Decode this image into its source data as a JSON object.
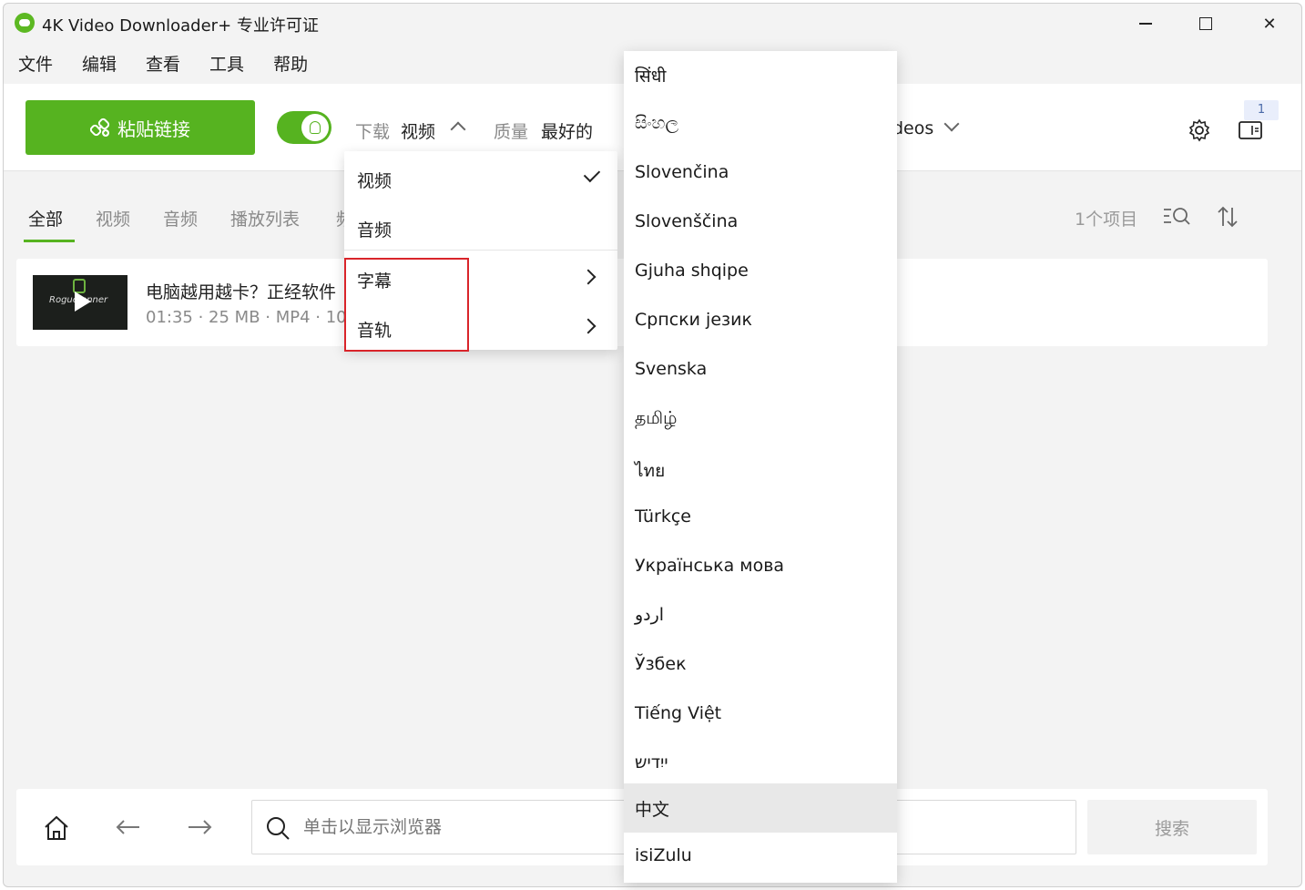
{
  "window": {
    "title": "4K Video Downloader+ 专业许可证",
    "min_label": "",
    "max_label": "",
    "close_label": "✕"
  },
  "menu": [
    "文件",
    "编辑",
    "查看",
    "工具",
    "帮助"
  ],
  "toolbar": {
    "paste_label": "粘贴链接",
    "download_label": "下载",
    "download_value": "视频",
    "quality_label": "质量",
    "quality_value": "最好的",
    "folder_partial": "deos",
    "badge_count": "1"
  },
  "tabs": [
    "全部",
    "视频",
    "音频",
    "播放列表",
    "频"
  ],
  "item_count": "1个项目",
  "item": {
    "title": "电脑越用越卡？正经软件",
    "meta": "01:35 · 25 MB · MP4 · 10",
    "thumb_text": "Rogue  anner"
  },
  "dropdown": {
    "items": [
      {
        "label": "视频",
        "checked": true
      },
      {
        "label": "音频",
        "checked": false
      },
      {
        "label": "字幕",
        "submenu": true
      },
      {
        "label": "音轨",
        "submenu": true
      }
    ]
  },
  "languages": [
    "सिंधी",
    "සිංහල",
    "Slovenčina",
    "Slovenščina",
    "Gjuha shqipe",
    "Српски језик",
    "Svenska",
    "தமிழ்",
    "ไทย",
    "Türkçe",
    "Українська мова",
    "اردو",
    "Ўзбек",
    "Tiếng Việt",
    "ייִדיש",
    "中文",
    "isiZulu"
  ],
  "selected_language": "中文",
  "bottom": {
    "url_placeholder": "单击以显示浏览器",
    "search_label": "搜索"
  },
  "colors": {
    "accent": "#56b320",
    "highlight_border": "#d9242a"
  }
}
